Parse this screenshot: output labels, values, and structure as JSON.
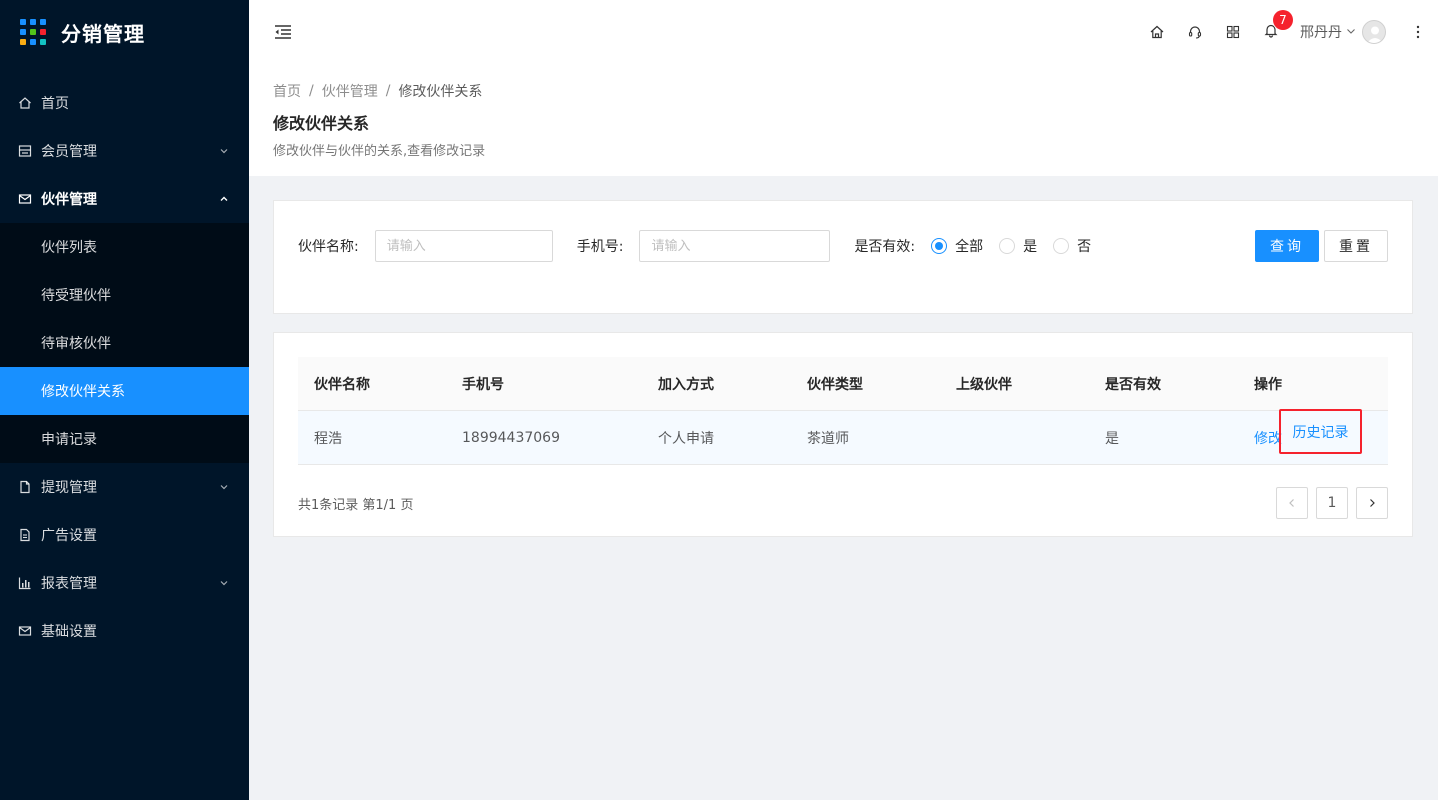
{
  "app": {
    "title": "分销管理"
  },
  "sidebar": {
    "items": [
      {
        "label": "首页"
      },
      {
        "label": "会员管理"
      },
      {
        "label": "伙伴管理"
      },
      {
        "label": "提现管理"
      },
      {
        "label": "广告设置"
      },
      {
        "label": "报表管理"
      },
      {
        "label": "基础设置"
      }
    ],
    "sub_items": [
      {
        "label": "伙伴列表"
      },
      {
        "label": "待受理伙伴"
      },
      {
        "label": "待审核伙伴"
      },
      {
        "label": "修改伙伴关系"
      },
      {
        "label": "申请记录"
      }
    ]
  },
  "header": {
    "notification_count": "7",
    "user_name": "邢丹丹"
  },
  "breadcrumb": [
    "首页",
    "伙伴管理",
    "修改伙伴关系"
  ],
  "page": {
    "title": "修改伙伴关系",
    "description": "修改伙伴与伙伴的关系,查看修改记录"
  },
  "search": {
    "name_label": "伙伴名称:",
    "name_placeholder": "请输入",
    "phone_label": "手机号:",
    "phone_placeholder": "请输入",
    "valid_label": "是否有效:",
    "options": [
      "全部",
      "是",
      "否"
    ],
    "selected": "全部",
    "query_button": "查询",
    "reset_button": "重置"
  },
  "table": {
    "columns": [
      "伙伴名称",
      "手机号",
      "加入方式",
      "伙伴类型",
      "上级伙伴",
      "是否有效",
      "操作"
    ],
    "rows": [
      {
        "name": "程浩",
        "phone": "18994437069",
        "join_method": "个人申请",
        "type": "茶道师",
        "parent": "",
        "valid": "是",
        "action_edit": "修改",
        "action_history": "历史记录"
      }
    ],
    "summary": "共1条记录 第1/1 页",
    "current_page": "1"
  },
  "colors": {
    "sidebar_bg": "#001529",
    "submenu_bg": "#000c17",
    "primary": "#1890ff",
    "highlight_border": "#f5222d"
  }
}
